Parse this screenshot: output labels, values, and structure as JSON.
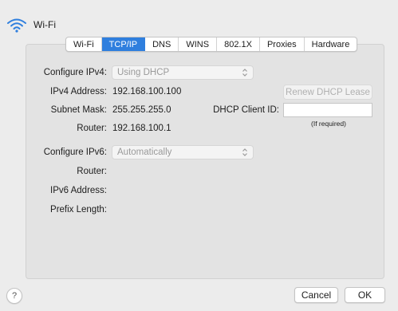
{
  "header": {
    "title": "Wi-Fi",
    "icon": "wifi-icon"
  },
  "tabs": [
    {
      "label": "Wi-Fi",
      "active": false
    },
    {
      "label": "TCP/IP",
      "active": true
    },
    {
      "label": "DNS",
      "active": false
    },
    {
      "label": "WINS",
      "active": false
    },
    {
      "label": "802.1X",
      "active": false
    },
    {
      "label": "Proxies",
      "active": false
    },
    {
      "label": "Hardware",
      "active": false
    }
  ],
  "ipv4": {
    "configure_label": "Configure IPv4:",
    "configure_value": "Using DHCP",
    "address_label": "IPv4 Address:",
    "address_value": "192.168.100.100",
    "subnet_label": "Subnet Mask:",
    "subnet_value": "255.255.255.0",
    "router_label": "Router:",
    "router_value": "192.168.100.1",
    "renew_button": "Renew DHCP Lease",
    "client_id_label": "DHCP Client ID:",
    "client_id_value": "",
    "client_id_hint": "(If required)"
  },
  "ipv6": {
    "configure_label": "Configure IPv6:",
    "configure_value": "Automatically",
    "router_label": "Router:",
    "address_label": "IPv6 Address:",
    "prefix_label": "Prefix Length:"
  },
  "footer": {
    "help_label": "?",
    "cancel_label": "Cancel",
    "ok_label": "OK"
  },
  "colors": {
    "accent": "#2f7fde",
    "background": "#ececec",
    "panel": "#e3e3e3"
  }
}
